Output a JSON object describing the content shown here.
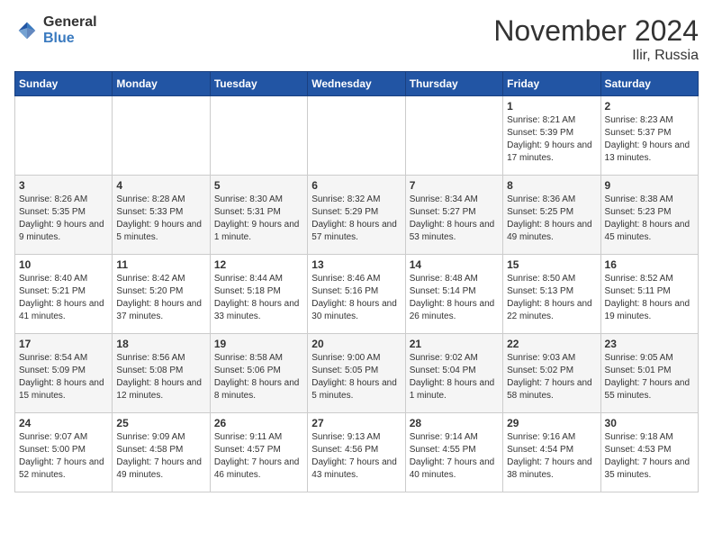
{
  "header": {
    "logo_general": "General",
    "logo_blue": "Blue",
    "month": "November 2024",
    "location": "Ilir, Russia"
  },
  "days_of_week": [
    "Sunday",
    "Monday",
    "Tuesday",
    "Wednesday",
    "Thursday",
    "Friday",
    "Saturday"
  ],
  "weeks": [
    [
      {
        "day": "",
        "info": ""
      },
      {
        "day": "",
        "info": ""
      },
      {
        "day": "",
        "info": ""
      },
      {
        "day": "",
        "info": ""
      },
      {
        "day": "",
        "info": ""
      },
      {
        "day": "1",
        "info": "Sunrise: 8:21 AM\nSunset: 5:39 PM\nDaylight: 9 hours and 17 minutes."
      },
      {
        "day": "2",
        "info": "Sunrise: 8:23 AM\nSunset: 5:37 PM\nDaylight: 9 hours and 13 minutes."
      }
    ],
    [
      {
        "day": "3",
        "info": "Sunrise: 8:26 AM\nSunset: 5:35 PM\nDaylight: 9 hours and 9 minutes."
      },
      {
        "day": "4",
        "info": "Sunrise: 8:28 AM\nSunset: 5:33 PM\nDaylight: 9 hours and 5 minutes."
      },
      {
        "day": "5",
        "info": "Sunrise: 8:30 AM\nSunset: 5:31 PM\nDaylight: 9 hours and 1 minute."
      },
      {
        "day": "6",
        "info": "Sunrise: 8:32 AM\nSunset: 5:29 PM\nDaylight: 8 hours and 57 minutes."
      },
      {
        "day": "7",
        "info": "Sunrise: 8:34 AM\nSunset: 5:27 PM\nDaylight: 8 hours and 53 minutes."
      },
      {
        "day": "8",
        "info": "Sunrise: 8:36 AM\nSunset: 5:25 PM\nDaylight: 8 hours and 49 minutes."
      },
      {
        "day": "9",
        "info": "Sunrise: 8:38 AM\nSunset: 5:23 PM\nDaylight: 8 hours and 45 minutes."
      }
    ],
    [
      {
        "day": "10",
        "info": "Sunrise: 8:40 AM\nSunset: 5:21 PM\nDaylight: 8 hours and 41 minutes."
      },
      {
        "day": "11",
        "info": "Sunrise: 8:42 AM\nSunset: 5:20 PM\nDaylight: 8 hours and 37 minutes."
      },
      {
        "day": "12",
        "info": "Sunrise: 8:44 AM\nSunset: 5:18 PM\nDaylight: 8 hours and 33 minutes."
      },
      {
        "day": "13",
        "info": "Sunrise: 8:46 AM\nSunset: 5:16 PM\nDaylight: 8 hours and 30 minutes."
      },
      {
        "day": "14",
        "info": "Sunrise: 8:48 AM\nSunset: 5:14 PM\nDaylight: 8 hours and 26 minutes."
      },
      {
        "day": "15",
        "info": "Sunrise: 8:50 AM\nSunset: 5:13 PM\nDaylight: 8 hours and 22 minutes."
      },
      {
        "day": "16",
        "info": "Sunrise: 8:52 AM\nSunset: 5:11 PM\nDaylight: 8 hours and 19 minutes."
      }
    ],
    [
      {
        "day": "17",
        "info": "Sunrise: 8:54 AM\nSunset: 5:09 PM\nDaylight: 8 hours and 15 minutes."
      },
      {
        "day": "18",
        "info": "Sunrise: 8:56 AM\nSunset: 5:08 PM\nDaylight: 8 hours and 12 minutes."
      },
      {
        "day": "19",
        "info": "Sunrise: 8:58 AM\nSunset: 5:06 PM\nDaylight: 8 hours and 8 minutes."
      },
      {
        "day": "20",
        "info": "Sunrise: 9:00 AM\nSunset: 5:05 PM\nDaylight: 8 hours and 5 minutes."
      },
      {
        "day": "21",
        "info": "Sunrise: 9:02 AM\nSunset: 5:04 PM\nDaylight: 8 hours and 1 minute."
      },
      {
        "day": "22",
        "info": "Sunrise: 9:03 AM\nSunset: 5:02 PM\nDaylight: 7 hours and 58 minutes."
      },
      {
        "day": "23",
        "info": "Sunrise: 9:05 AM\nSunset: 5:01 PM\nDaylight: 7 hours and 55 minutes."
      }
    ],
    [
      {
        "day": "24",
        "info": "Sunrise: 9:07 AM\nSunset: 5:00 PM\nDaylight: 7 hours and 52 minutes."
      },
      {
        "day": "25",
        "info": "Sunrise: 9:09 AM\nSunset: 4:58 PM\nDaylight: 7 hours and 49 minutes."
      },
      {
        "day": "26",
        "info": "Sunrise: 9:11 AM\nSunset: 4:57 PM\nDaylight: 7 hours and 46 minutes."
      },
      {
        "day": "27",
        "info": "Sunrise: 9:13 AM\nSunset: 4:56 PM\nDaylight: 7 hours and 43 minutes."
      },
      {
        "day": "28",
        "info": "Sunrise: 9:14 AM\nSunset: 4:55 PM\nDaylight: 7 hours and 40 minutes."
      },
      {
        "day": "29",
        "info": "Sunrise: 9:16 AM\nSunset: 4:54 PM\nDaylight: 7 hours and 38 minutes."
      },
      {
        "day": "30",
        "info": "Sunrise: 9:18 AM\nSunset: 4:53 PM\nDaylight: 7 hours and 35 minutes."
      }
    ]
  ]
}
